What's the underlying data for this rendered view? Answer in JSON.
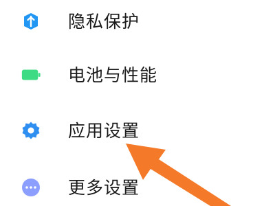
{
  "settings": {
    "items": [
      {
        "label": "隐私保护",
        "icon": "privacy-shield-icon",
        "icon_color": "#2196f3"
      },
      {
        "label": "电池与性能",
        "icon": "battery-icon",
        "icon_color": "#3ddc84"
      },
      {
        "label": "应用设置",
        "icon": "gear-icon",
        "icon_color": "#2f8ff0"
      },
      {
        "label": "更多设置",
        "icon": "more-dots-icon",
        "icon_color": "#8c9eff"
      }
    ]
  },
  "annotation": {
    "icon": "pointer-arrow-icon",
    "color": "#f47a2a"
  }
}
